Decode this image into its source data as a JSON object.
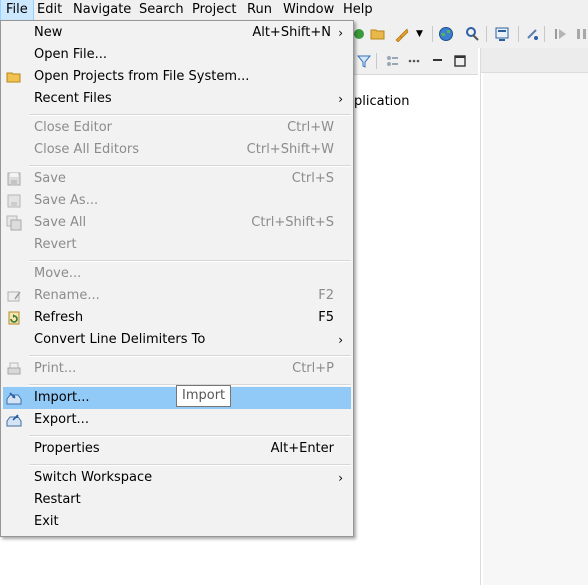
{
  "menubar": {
    "items": [
      "File",
      "Edit",
      "Navigate",
      "Search",
      "Project",
      "Run",
      "Window",
      "Help"
    ]
  },
  "editor": {
    "partial_text": "plication"
  },
  "file_menu": {
    "items": [
      {
        "label": "New",
        "accel": "Alt+Shift+N",
        "submenu": true,
        "enabled": true
      },
      {
        "label": "Open File...",
        "accel": "",
        "enabled": true
      },
      {
        "label": "Open Projects from File System...",
        "accel": "",
        "enabled": true,
        "icon": "folder-icon"
      },
      {
        "label": "Recent Files",
        "accel": "",
        "submenu": true,
        "enabled": true
      },
      {
        "label": "Close Editor",
        "accel": "Ctrl+W",
        "enabled": false
      },
      {
        "label": "Close All Editors",
        "accel": "Ctrl+Shift+W",
        "enabled": false
      },
      {
        "label": "Save",
        "accel": "Ctrl+S",
        "enabled": false,
        "icon": "save-icon"
      },
      {
        "label": "Save As...",
        "accel": "",
        "enabled": false,
        "icon": "save-as-icon"
      },
      {
        "label": "Save All",
        "accel": "Ctrl+Shift+S",
        "enabled": false,
        "icon": "save-all-icon"
      },
      {
        "label": "Revert",
        "accel": "",
        "enabled": false
      },
      {
        "label": "Move...",
        "accel": "",
        "enabled": false
      },
      {
        "label": "Rename...",
        "accel": "F2",
        "enabled": false,
        "icon": "rename-icon"
      },
      {
        "label": "Refresh",
        "accel": "F5",
        "enabled": true,
        "icon": "refresh-icon"
      },
      {
        "label": "Convert Line Delimiters To",
        "accel": "",
        "submenu": true,
        "enabled": true
      },
      {
        "label": "Print...",
        "accel": "Ctrl+P",
        "enabled": false,
        "icon": "print-icon"
      },
      {
        "label": "Import...",
        "accel": "",
        "enabled": true,
        "selected": true,
        "icon": "import-icon"
      },
      {
        "label": "Export...",
        "accel": "",
        "enabled": true,
        "icon": "export-icon"
      },
      {
        "label": "Properties",
        "accel": "Alt+Enter",
        "enabled": true
      },
      {
        "label": "Switch Workspace",
        "accel": "",
        "submenu": true,
        "enabled": true
      },
      {
        "label": "Restart",
        "accel": "",
        "enabled": true
      },
      {
        "label": "Exit",
        "accel": "",
        "enabled": true
      }
    ],
    "submenu_arrow": "›"
  },
  "tooltip": {
    "text": "Import"
  },
  "colors": {
    "menu_bg": "#f2f2f2",
    "selected_bg": "#91c9f7",
    "disabled_text": "#8c8c8c",
    "active_menubar_bg": "#cce8ff"
  }
}
